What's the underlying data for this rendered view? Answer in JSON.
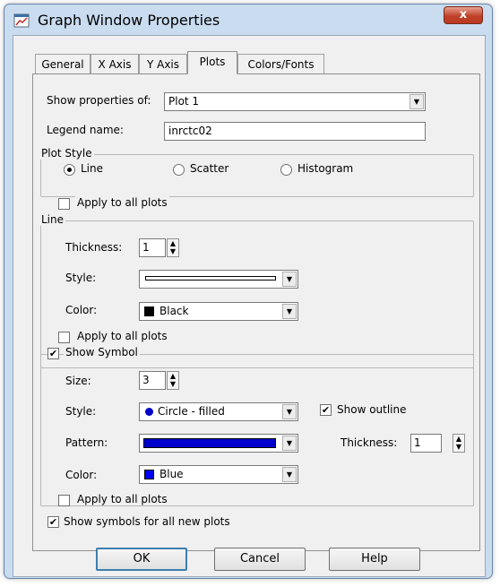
{
  "window": {
    "title": "Graph Window Properties",
    "close_label": "x"
  },
  "tabs": [
    {
      "label": "General"
    },
    {
      "label": "X Axis"
    },
    {
      "label": "Y Axis"
    },
    {
      "label": "Plots"
    },
    {
      "label": "Colors/Fonts"
    }
  ],
  "active_tab": "Plots",
  "plots": {
    "show_properties_label": "Show properties of:",
    "show_properties_value": "Plot 1",
    "legend_name_label": "Legend name:",
    "legend_name_value": "inrctc02",
    "plot_style": {
      "title": "Plot Style",
      "options": [
        {
          "label": "Line",
          "selected": true
        },
        {
          "label": "Scatter",
          "selected": false
        },
        {
          "label": "Histogram",
          "selected": false
        }
      ],
      "apply_all_label": "Apply to all plots",
      "apply_all_checked": false
    },
    "line": {
      "title": "Line",
      "thickness_label": "Thickness:",
      "thickness_value": "1",
      "style_label": "Style:",
      "color_label": "Color:",
      "color_value": "Black",
      "color_hex": "#000000",
      "apply_all_label": "Apply to all plots",
      "apply_all_checked": false
    },
    "symbol": {
      "show_symbol_label": "Show Symbol",
      "show_symbol_checked": true,
      "size_label": "Size:",
      "size_value": "3",
      "style_label": "Style:",
      "style_value": "Circle - filled",
      "show_outline_label": "Show outline",
      "show_outline_checked": true,
      "pattern_label": "Pattern:",
      "pattern_color_hex": "#0000cc",
      "thickness_label": "Thickness:",
      "thickness_value": "1",
      "color_label": "Color:",
      "color_value": "Blue",
      "color_hex": "#0000ff",
      "apply_all_label": "Apply to all plots",
      "apply_all_checked": false
    },
    "show_symbols_new_label": "Show symbols for all new plots",
    "show_symbols_new_checked": true
  },
  "buttons": {
    "ok": "OK",
    "cancel": "Cancel",
    "help": "Help"
  }
}
